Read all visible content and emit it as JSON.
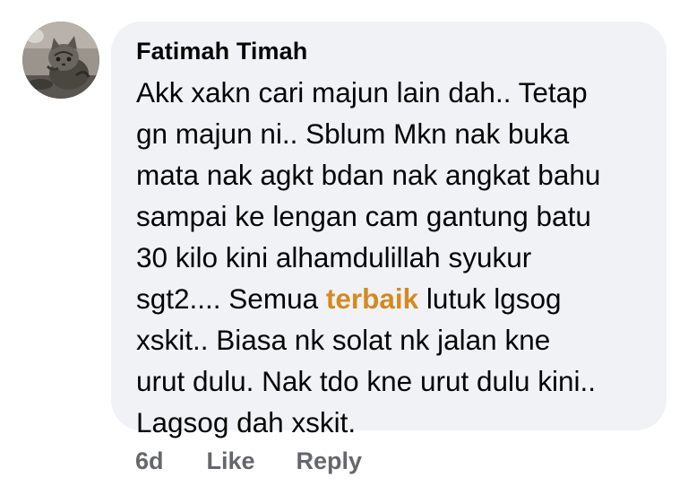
{
  "comment": {
    "author": "Fatimah Timah",
    "lines": [
      {
        "before": "Akk xakn cari majun lain dah.. Tetap"
      },
      {
        "before": "gn majun ni.. Sblum Mkn nak buka"
      },
      {
        "before": "mata nak agkt bdan nak angkat bahu"
      },
      {
        "before": "sampai ke lengan cam gantung batu"
      },
      {
        "before": "30 kilo kini alhamdulillah syukur"
      },
      {
        "before": "sgt2.... Semua ",
        "highlight": "terbaik",
        "after": " lutuk lgsog"
      },
      {
        "before": "xskit.. Biasa nk solat nk jalan kne"
      },
      {
        "before": "urut dulu. Nak tdo kne urut dulu kini.."
      },
      {
        "before": "Lagsog dah xskit."
      }
    ],
    "highlight_color": "#d48a1f"
  },
  "actions": {
    "timestamp": "6d",
    "like_label": "Like",
    "reply_label": "Reply"
  },
  "colors": {
    "bubble_bg": "#f0f2f5",
    "text": "#050505",
    "secondary": "#65676b"
  },
  "avatar": {
    "icon": "kitten-photo-avatar"
  }
}
